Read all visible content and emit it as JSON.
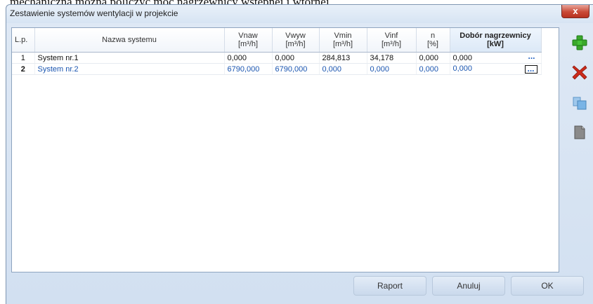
{
  "background_text": "mechaniczną można policzyć moc nagrzewnicy wstępnej i wtórnej.",
  "window": {
    "title": "Zestawienie systemów wentylacji w projekcie",
    "close_label": "x"
  },
  "table": {
    "headers": {
      "lp": "L.p.",
      "nazwa": "Nazwa systemu",
      "vnaw": [
        "Vnaw",
        "[m³/h]"
      ],
      "vwyw": [
        "Vwyw",
        "[m³/h]"
      ],
      "vmin": [
        "Vmin",
        "[m³/h]"
      ],
      "vinf": [
        "Vinf",
        "[m³/h]"
      ],
      "n": [
        "n",
        "[%]"
      ],
      "dobor": [
        "Dobór nagrzewnicy",
        "[kW]"
      ]
    },
    "rows": [
      {
        "lp": "1",
        "nazwa": "System nr.1",
        "vnaw": "0,000",
        "vwyw": "0,000",
        "vmin": "284,813",
        "vinf": "34,178",
        "n": "0,000",
        "dobor": "0,000",
        "more": "..."
      },
      {
        "lp": "2",
        "nazwa": "System nr.2",
        "vnaw": "6790,000",
        "vwyw": "6790,000",
        "vmin": "0,000",
        "vinf": "0,000",
        "n": "0,000",
        "dobor": "0,000",
        "more": "..."
      }
    ],
    "selected_row": 2
  },
  "toolbar": {
    "add_icon": "plus-icon",
    "delete_icon": "delete-x-icon",
    "copy_icon": "copy-icon",
    "paste_icon": "paste-icon"
  },
  "footer": {
    "raport": "Raport",
    "anuluj": "Anuluj",
    "ok": "OK"
  },
  "colors": {
    "accent_blue": "#1a55b0",
    "add_green": "#3aa82b",
    "delete_red": "#cc2a1a"
  }
}
